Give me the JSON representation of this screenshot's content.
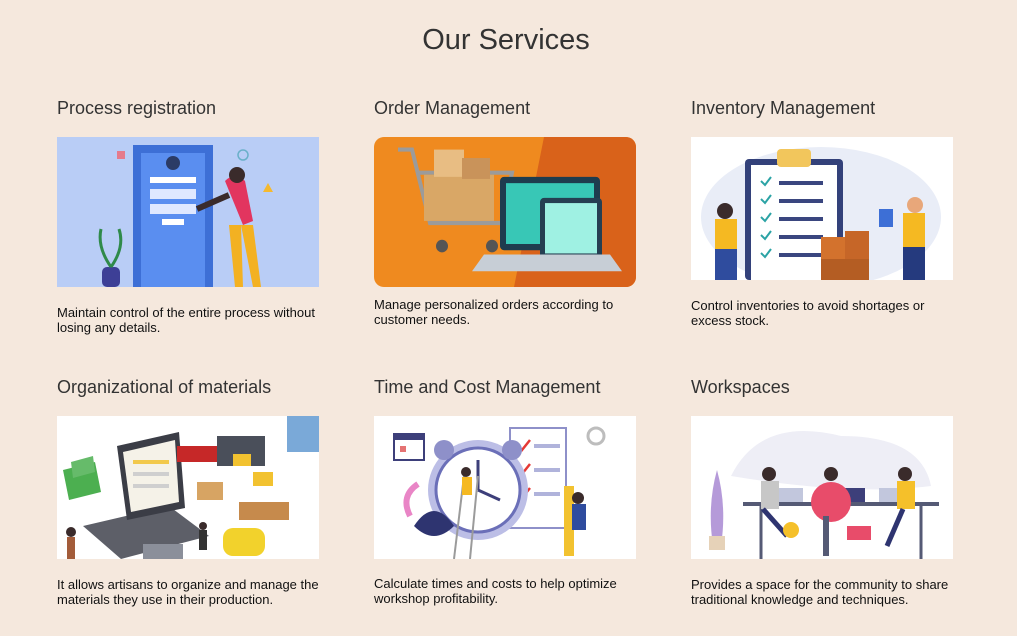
{
  "page": {
    "title": "Our Services"
  },
  "services": [
    {
      "title": "Process registration",
      "description": "Maintain control of the entire process without losing any details.",
      "icon": "registration-illustration"
    },
    {
      "title": "Order Management",
      "description": "Manage personalized orders according to customer needs.",
      "icon": "order-illustration"
    },
    {
      "title": "Inventory Management",
      "description": "Control inventories to avoid shortages or excess stock.",
      "icon": "inventory-illustration"
    },
    {
      "title": "Organizational of materials",
      "description": "It allows artisans to organize and manage the materials they use in their production.",
      "icon": "materials-illustration"
    },
    {
      "title": "Time and Cost Management",
      "description": "Calculate times and costs to help optimize workshop profitability.",
      "icon": "time-cost-illustration"
    },
    {
      "title": "Workspaces",
      "description": "Provides a space for the community to share traditional knowledge and techniques.",
      "icon": "workspaces-illustration"
    }
  ],
  "colors": {
    "background": "#f5e8dd",
    "heading": "#333333",
    "text": "#111111"
  }
}
